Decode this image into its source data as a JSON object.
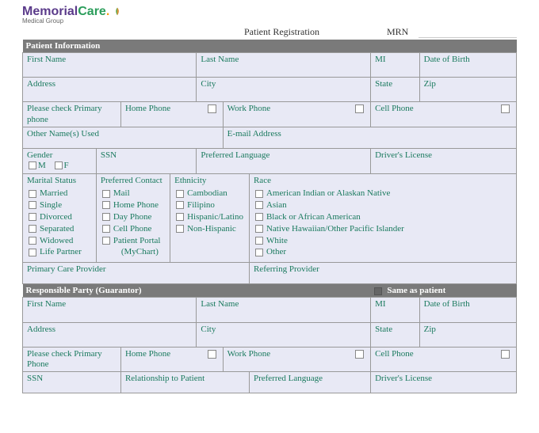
{
  "logo": {
    "part1": "Memorial",
    "part2": "Care",
    "dot": ".",
    "sub": "Medical Group"
  },
  "header": {
    "title": "Patient Registration",
    "mrn_label": "MRN"
  },
  "sections": {
    "patient_info": "Patient Information",
    "responsible": "Responsible Party (Guarantor)",
    "same_as_patient": "Same as patient"
  },
  "labels": {
    "first_name": "First Name",
    "last_name": "Last Name",
    "mi": "MI",
    "dob": "Date of Birth",
    "address": "Address",
    "city": "City",
    "state": "State",
    "zip": "Zip",
    "primary_phone": "Please check Primary phone",
    "primary_phone2": "Please check Primary Phone",
    "home_phone": "Home Phone",
    "work_phone": "Work Phone",
    "cell_phone": "Cell Phone",
    "other_names": "Other Name(s) Used",
    "email": "E-mail Address",
    "gender": "Gender",
    "gender_m": "M",
    "gender_f": "F",
    "ssn": "SSN",
    "preferred_language": "Preferred Language",
    "drivers_license": "Driver's License",
    "marital_status": "Marital Status",
    "preferred_contact": "Preferred Contact",
    "ethnicity": "Ethnicity",
    "race": "Race",
    "pcp": "Primary Care Provider",
    "referring": "Referring Provider",
    "relationship": "Relationship to Patient"
  },
  "marital_options": [
    "Married",
    "Single",
    "Divorced",
    "Separated",
    "Widowed",
    "Life Partner"
  ],
  "contact_options": [
    "Mail",
    "Home Phone",
    "Day Phone",
    "Cell Phone",
    "Patient Portal (MyChart)"
  ],
  "ethnicity_options": [
    "Cambodian",
    "Filipino",
    "Hispanic/Latino",
    "Non-Hispanic"
  ],
  "race_options": [
    "American Indian or Alaskan Native",
    "Asian",
    "Black or African American",
    "Native Hawaiian/Other Pacific Islander",
    "White",
    "Other"
  ]
}
